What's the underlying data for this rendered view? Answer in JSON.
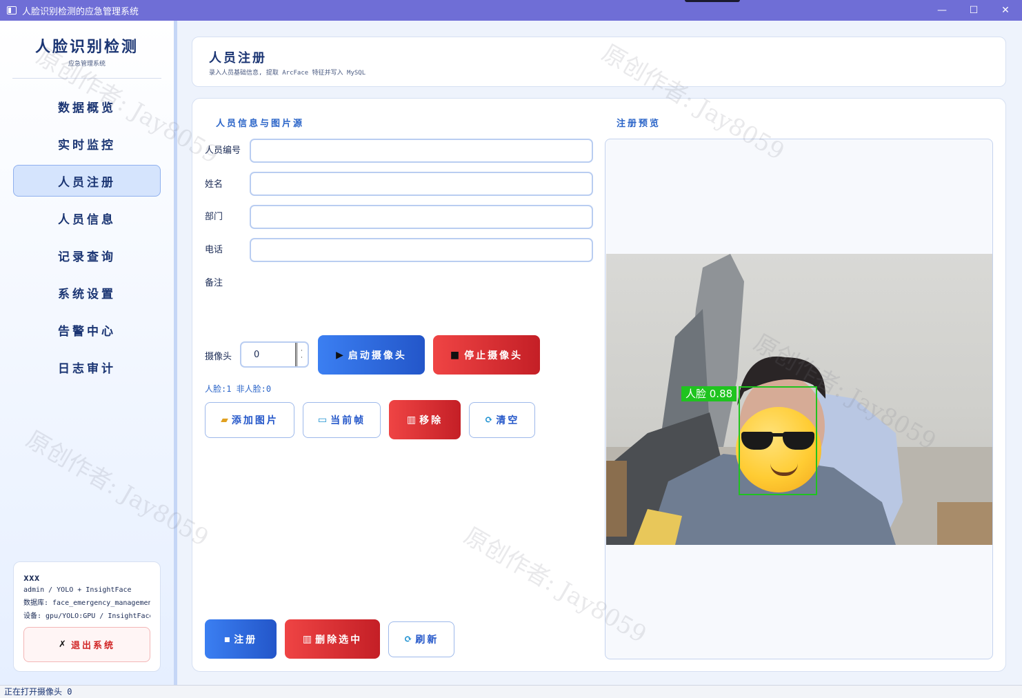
{
  "window": {
    "title": "人脸识别检测的应急管理系统",
    "minimize": "—",
    "maximize": "☐",
    "close": "✕"
  },
  "sidebar": {
    "brand_title": "人脸识别检测",
    "brand_subtitle": "应急管理系统",
    "items": [
      {
        "label": "数据概览",
        "active": false
      },
      {
        "label": "实时监控",
        "active": false
      },
      {
        "label": "人员注册",
        "active": true
      },
      {
        "label": "人员信息",
        "active": false
      },
      {
        "label": "记录查询",
        "active": false
      },
      {
        "label": "系统设置",
        "active": false
      },
      {
        "label": "告警中心",
        "active": false
      },
      {
        "label": "日志审计",
        "active": false
      }
    ],
    "user": {
      "name": "xxx",
      "role_line": "admin / YOLO + InsightFace",
      "db_line": "数据库: face_emergency_management",
      "device_line": "设备: gpu/YOLO:GPU / InsightFace"
    },
    "logout_label": "退出系统"
  },
  "header": {
    "title": "人员注册",
    "subtitle": "录入人员基础信息, 提取 ArcFace 特征并写入 MySQL"
  },
  "form": {
    "section_title": "人员信息与图片源",
    "fields": [
      {
        "label": "人员编号",
        "value": ""
      },
      {
        "label": "姓名",
        "value": ""
      },
      {
        "label": "部门",
        "value": ""
      },
      {
        "label": "电话",
        "value": ""
      }
    ],
    "note_label": "备注",
    "camera_label": "摄像头",
    "camera_value": "0",
    "start_camera": "启动摄像头",
    "stop_camera": "停止摄像头",
    "stats": "人脸:1  非人脸:0",
    "add_image": "添加图片",
    "current_frame": "当前帧",
    "remove": "移除",
    "clear": "清空",
    "register": "注册",
    "delete_selected": "删除选中",
    "refresh": "刷新"
  },
  "preview": {
    "section_title": "注册预览",
    "detection_label": "人脸 0.88",
    "detection_confidence": 0.88
  },
  "status_bar": {
    "text": "正在打开摄像头 0"
  },
  "watermark": "原创作者: Jay8059",
  "colors": {
    "titlebar": "#6f6ed6",
    "accent_blue": "#2356c9",
    "accent_red": "#d02424",
    "detection_green": "#1fc41f"
  }
}
